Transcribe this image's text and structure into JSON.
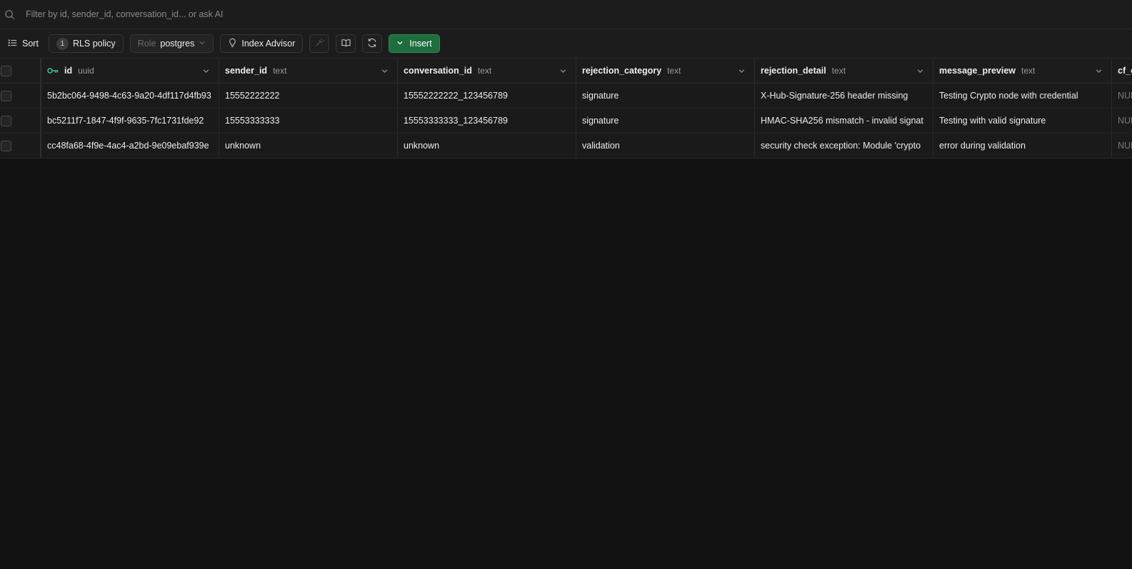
{
  "search": {
    "placeholder": "Filter by id, sender_id, conversation_id... or ask AI"
  },
  "toolbar": {
    "sort_label": "Sort",
    "rls_count": "1",
    "rls_label": "RLS policy",
    "role_prefix": "Role",
    "role_value": "postgres",
    "index_advisor_label": "Index Advisor",
    "insert_label": "Insert",
    "insert_color": "#1f6d3f"
  },
  "table": {
    "columns": [
      {
        "name": "id",
        "type": "uuid",
        "primary_key": true
      },
      {
        "name": "sender_id",
        "type": "text"
      },
      {
        "name": "conversation_id",
        "type": "text"
      },
      {
        "name": "rejection_category",
        "type": "text"
      },
      {
        "name": "rejection_detail",
        "type": "text"
      },
      {
        "name": "message_preview",
        "type": "text"
      },
      {
        "name": "cf_c",
        "type": ""
      }
    ],
    "rows": [
      {
        "id": "5b2bc064-9498-4c63-9a20-4df117d4fb93",
        "sender_id": "15552222222",
        "conversation_id": "15552222222_123456789",
        "rejection_category": "signature",
        "rejection_detail": "X-Hub-Signature-256 header missing",
        "message_preview": "Testing Crypto node with credential",
        "cf_c": "NUL"
      },
      {
        "id": "bc5211f7-1847-4f9f-9635-7fc1731fde92",
        "sender_id": "15553333333",
        "conversation_id": "15553333333_123456789",
        "rejection_category": "signature",
        "rejection_detail": "HMAC-SHA256 mismatch - invalid signat",
        "message_preview": "Testing with valid signature",
        "cf_c": "NUL"
      },
      {
        "id": "cc48fa68-4f9e-4ac4-a2bd-9e09ebaf939e",
        "sender_id": "unknown",
        "conversation_id": "unknown",
        "rejection_category": "validation",
        "rejection_detail": "security check exception: Module 'crypto",
        "message_preview": "error during validation",
        "cf_c": "NUL"
      }
    ]
  },
  "icons": {
    "search": "search-icon",
    "sort": "list-icon",
    "index_advisor": "lightbulb-icon",
    "sparkle": "wand-icon",
    "docs": "book-icon",
    "refresh": "refresh-icon",
    "insert": "chevron-down-icon",
    "primary_key": "key-icon",
    "column_menu": "chevron-down-icon"
  },
  "colors": {
    "primary_key": "#3ecf8e",
    "insert_border": "#2e8a52"
  }
}
